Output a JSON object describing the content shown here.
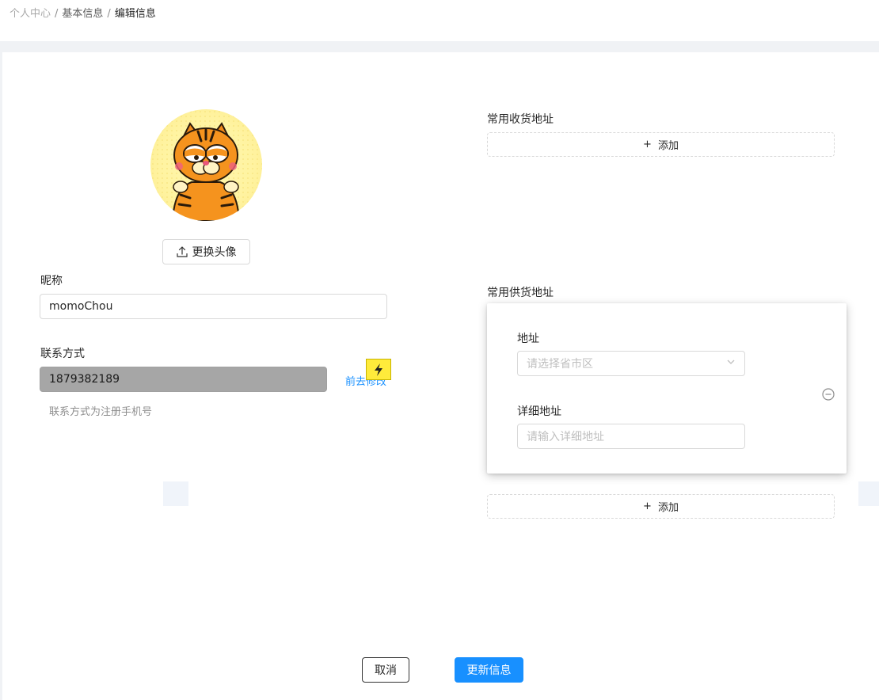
{
  "breadcrumb": {
    "item1": "个人中心",
    "item2": "基本信息",
    "item3": "编辑信息",
    "separator": "/"
  },
  "profile": {
    "upload_label": "更换头像",
    "nickname_label": "昵称",
    "nickname_value": "momoChou",
    "contact_label": "联系方式",
    "contact_value": "1879382189",
    "goto_modify": "前去修改",
    "contact_hint": "联系方式为注册手机号"
  },
  "shipping": {
    "title": "常用收货地址",
    "add_label": "添加"
  },
  "supply": {
    "title": "常用供货地址",
    "address_label": "地址",
    "address_placeholder": "请选择省市区",
    "detail_label": "详细地址",
    "detail_placeholder": "请输入详细地址",
    "add_label": "添加"
  },
  "footer": {
    "cancel_label": "取消",
    "update_label": "更新信息"
  },
  "colors": {
    "primary": "#1890ff",
    "page_bg": "#f0f2f5",
    "disabled_input": "#a6a6a6"
  }
}
